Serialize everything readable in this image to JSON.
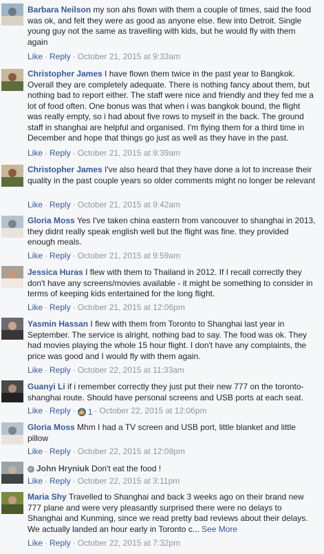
{
  "actions": {
    "like": "Like",
    "reply": "Reply",
    "sep": "·",
    "see_more": "See More"
  },
  "comments": [
    {
      "author": "Barbara Neilson",
      "text": "my son ahs flown with them a couple of times, said the food was ok, and felt they were as good as anyone else. flew into Detroit. Single young guy not the same as travelling with kids, but he would fly with them again",
      "timestamp": "October 21, 2015 at 9:33am",
      "avatar_colors": [
        "#9fb3c7",
        "#d7d2c4",
        "#6b7a85"
      ]
    },
    {
      "author": "Christopher James",
      "text": "I have flown them twice in the past year to Bangkok. Overall they are completely adequate. There is nothing fancy about them, but nothing bad to report either. The staff were nice and friendly and they fed me a lot of food often. One bonus was that when i was bangkok bound, the flight was really empty, so i had about five rows to myself in the back. The ground staff in shanghai are helpful and organised. I'm flying them for a third time in December and hope that things go just as well as they have in the past.",
      "timestamp": "October 21, 2015 at 9:39am",
      "avatar_colors": [
        "#c9b79a",
        "#5d6e3c",
        "#8c5a3c"
      ]
    },
    {
      "author": "Christopher James",
      "text": "I've also heard that they have done a lot to increase their quality in the past couple years so older comments might no longer be relevant",
      "timestamp": "October 21, 2015 at 9:42am",
      "avatar_colors": [
        "#c9b79a",
        "#5d6e3c",
        "#8c5a3c"
      ]
    },
    {
      "author": "Gloria Moss",
      "text": "Yes I've taken china eastern from vancouver to shanghai in 2013, they didnt really speak english well but the flight was fine. they provided enough meals.",
      "timestamp": "October 21, 2015 at 9:59am",
      "avatar_colors": [
        "#b5c3cf",
        "#e8e4dc",
        "#7a8590"
      ]
    },
    {
      "author": "Jessica Huras",
      "text": "I flew with them to Thailand in 2012. If I recall correctly they don't have any screens/movies available - it might be something to consider in terms of keeping kids entertained for the long flight.",
      "timestamp": "October 21, 2015 at 12:06pm",
      "avatar_colors": [
        "#a8a095",
        "#efe9e0",
        "#c49a7a"
      ]
    },
    {
      "author": "Yasmin Hassan",
      "text": "I flew with them from Toronto to Shanghai last year in September. The service is alright, nothing bad to say. The food was ok. They had movies playing the whole 15 hour flight. I don't have any complaints, the price was good and I would fly with them again.",
      "timestamp": "October 22, 2015 at 11:33am",
      "avatar_colors": [
        "#6e6a72",
        "#3a3438",
        "#c7a58e"
      ]
    },
    {
      "author": "Guanyi Li",
      "text": "if i remember correctly they just put their new 777 on the toronto-shanghai route. Should have personal screens and USB ports at each seat.",
      "timestamp": "October 22, 2015 at 12:06pm",
      "like_count": "1",
      "avatar_colors": [
        "#4a4a4a",
        "#222222",
        "#b08f78"
      ]
    },
    {
      "author": "Gloria Moss",
      "text": "Mhm I had a TV screen and USB port, little blanket and little pillow",
      "timestamp": "October 22, 2015 at 12:08pm",
      "avatar_colors": [
        "#b5c3cf",
        "#e8e4dc",
        "#7a8590"
      ]
    },
    {
      "author": "John Hryniuk",
      "text": "Don't eat the food !",
      "timestamp": "October 22, 2015 at 3:11pm",
      "avatar_colors": [
        "#9aa3a8",
        "#3f4448",
        "#c0b2a4"
      ]
    },
    {
      "author": "Maria Shy",
      "text": "Travelled to Shanghai and back 3 weeks ago on their brand new 777 plane and were very pleasantly surprised there were no delays to Shanghai and Kunming, since we read pretty bad reviews about their delays. We actually landed an hour early in Toronto c...",
      "timestamp": "October 22, 2015 at 7:32pm",
      "avatar_colors": [
        "#7b8b3e",
        "#4d5a2a",
        "#c69c7e"
      ]
    }
  ]
}
